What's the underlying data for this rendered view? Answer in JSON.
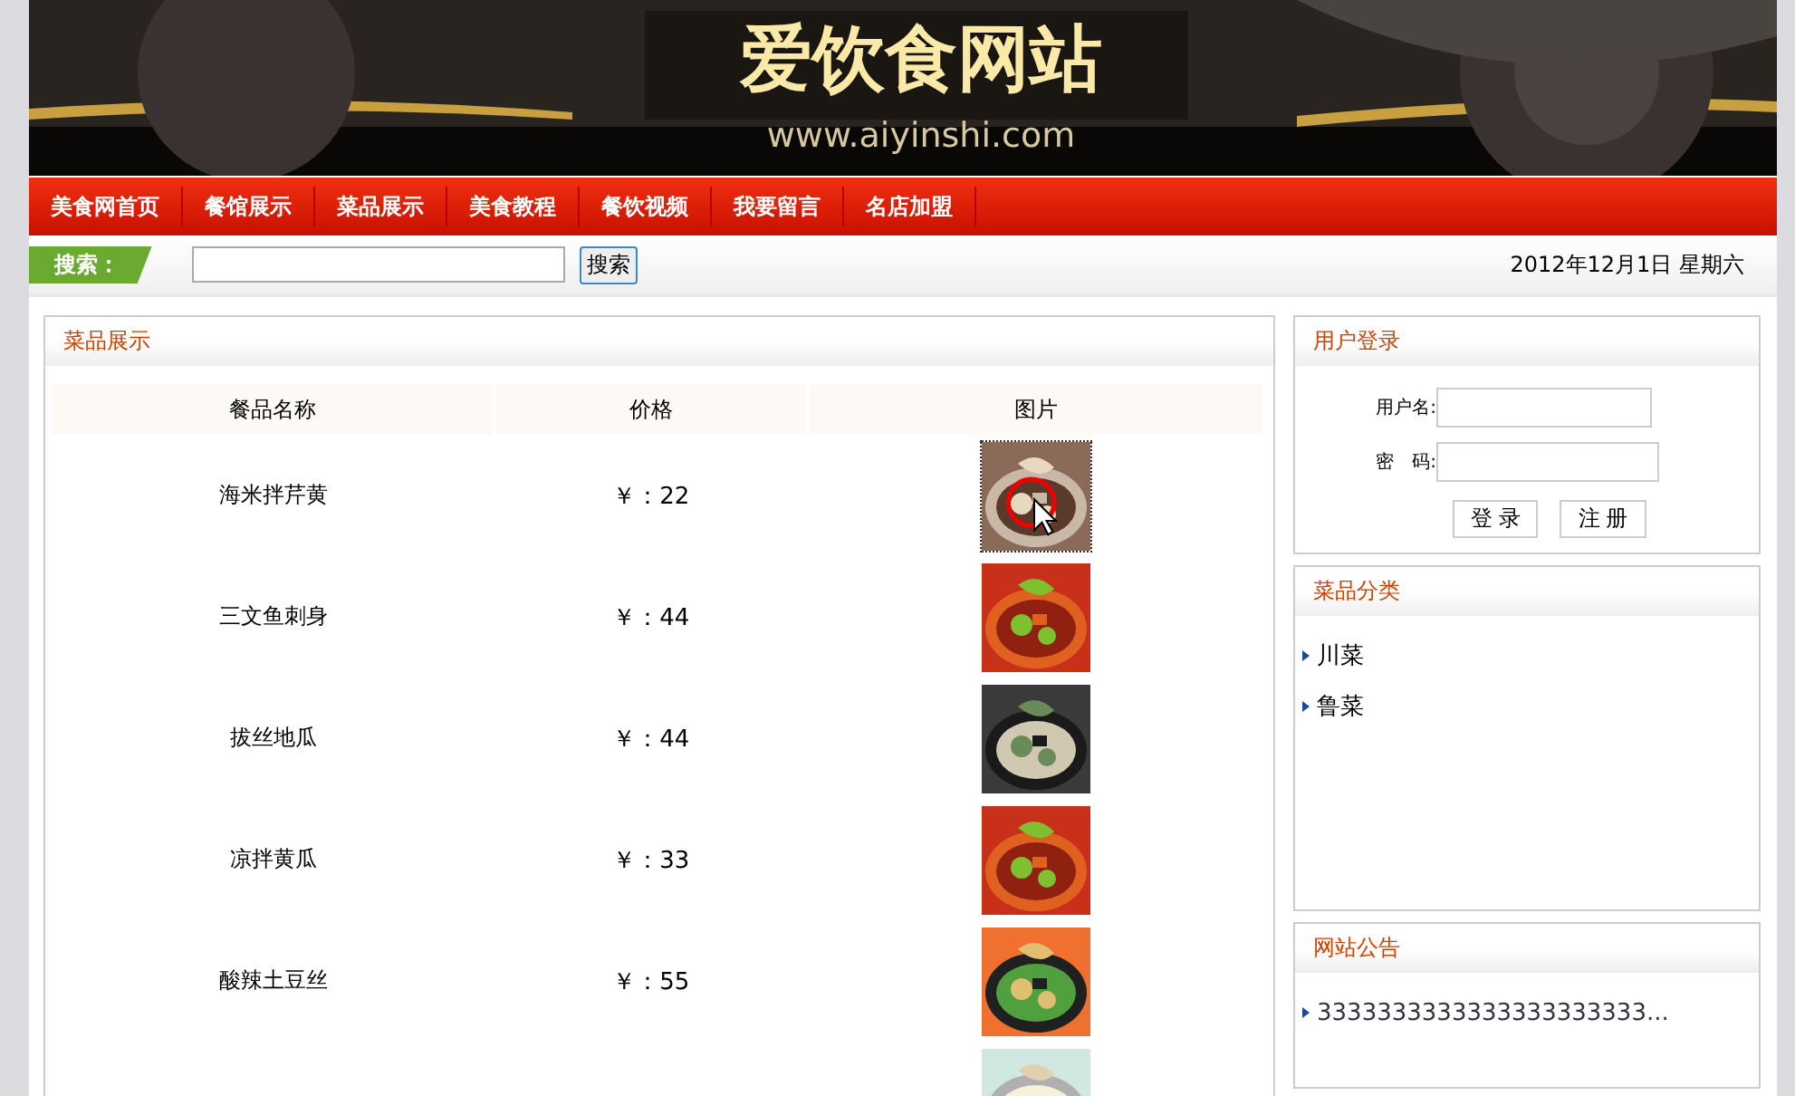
{
  "banner": {
    "title": "爱饮食网站",
    "url": "www.aiyinshi.com"
  },
  "nav": [
    "美食网首页",
    "餐馆展示",
    "菜品展示",
    "美食教程",
    "餐饮视频",
    "我要留言",
    "名店加盟"
  ],
  "search": {
    "label": "搜索：",
    "button": "搜索",
    "date": "2012年12月1日  星期六"
  },
  "dishes": {
    "title": "菜品展示",
    "columns": [
      "餐品名称",
      "价格",
      "图片"
    ],
    "rows": [
      {
        "name": "海米拌芹黄",
        "price": "￥：22",
        "focused": true
      },
      {
        "name": "三文鱼刺身",
        "price": "￥：44",
        "focused": false
      },
      {
        "name": "拔丝地瓜",
        "price": "￥：44",
        "focused": false
      },
      {
        "name": "凉拌黄瓜",
        "price": "￥：33",
        "focused": false
      },
      {
        "name": "酸辣土豆丝",
        "price": "￥：55",
        "focused": false
      },
      {
        "focused": false
      }
    ]
  },
  "login": {
    "title": "用户登录",
    "username_label": "用户名:",
    "password_label": "密　码:",
    "buttons": [
      "登 录",
      "注 册"
    ]
  },
  "categories": {
    "title": "菜品分类",
    "items": [
      "川菜",
      "鲁菜"
    ]
  },
  "notices": {
    "title": "网站公告",
    "items": [
      "3333333333333333333333..."
    ]
  }
}
